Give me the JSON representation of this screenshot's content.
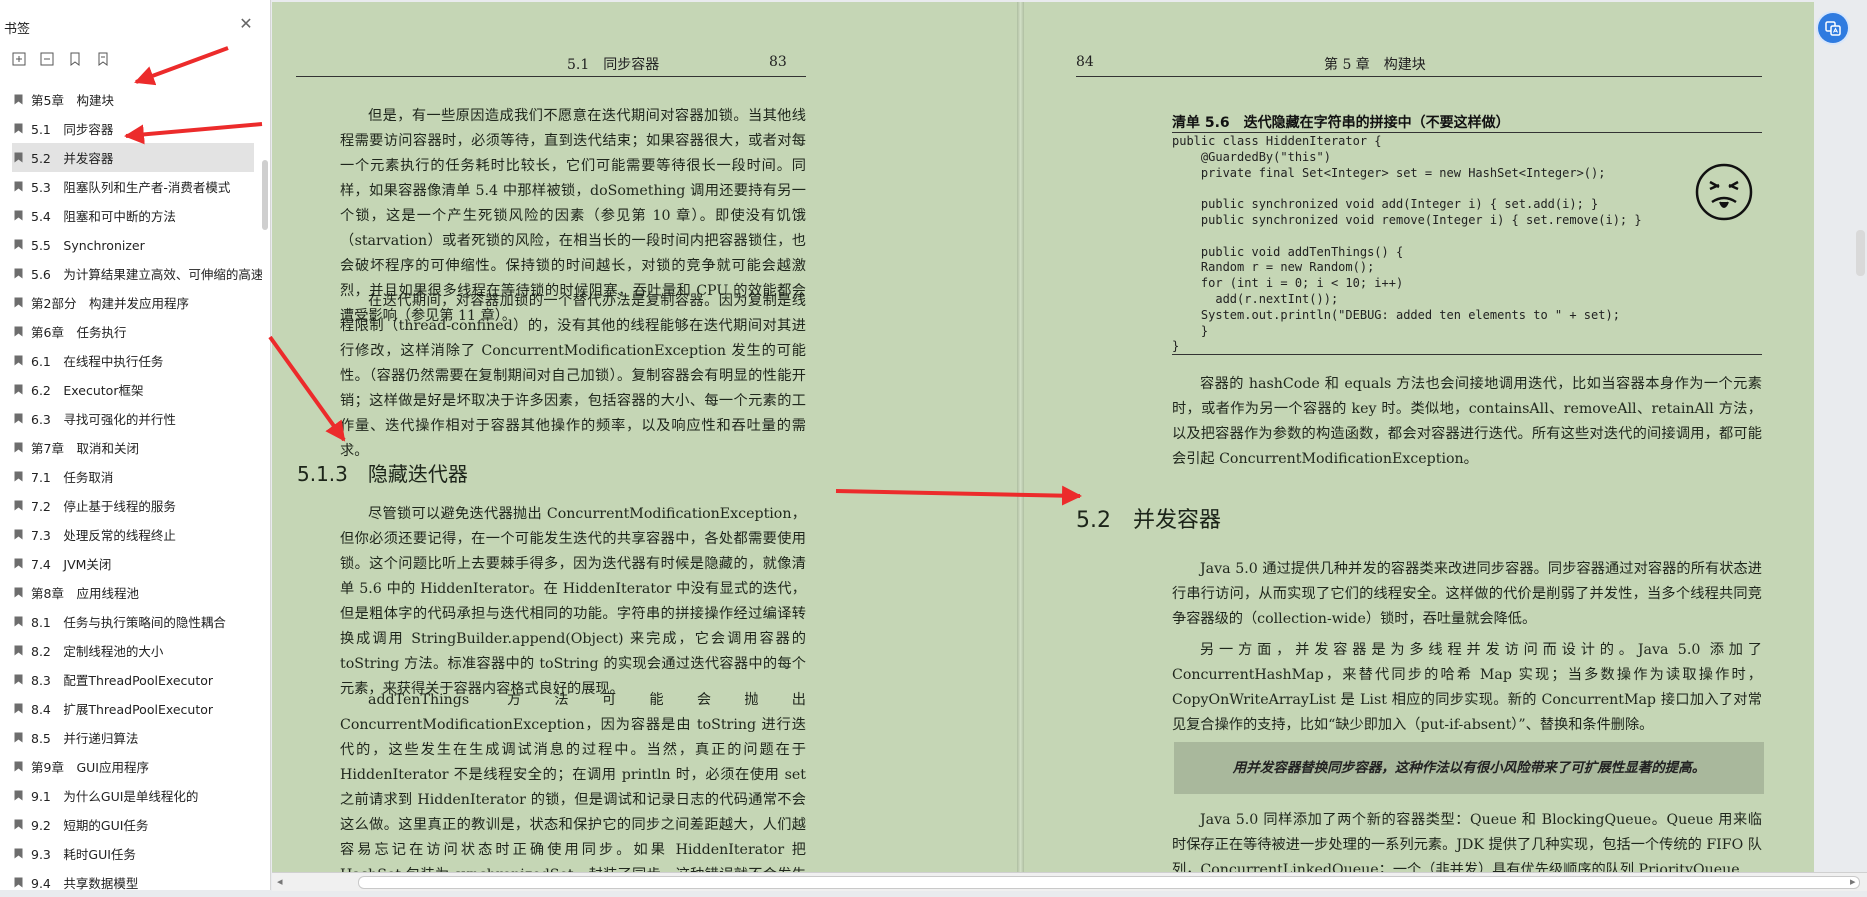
{
  "sidebar": {
    "title": "书签",
    "bookmarks": [
      {
        "label": "第5章　构建块"
      },
      {
        "label": "5.1　同步容器"
      },
      {
        "label": "5.2　并发容器"
      },
      {
        "label": "5.3　阻塞队列和生产者-消费者模式"
      },
      {
        "label": "5.4　阻塞和可中断的方法"
      },
      {
        "label": "5.5　Synchronizer"
      },
      {
        "label": "5.6　为计算结果建立高效、可伸缩的高速"
      },
      {
        "label": "第2部分　构建并发应用程序"
      },
      {
        "label": "第6章　任务执行"
      },
      {
        "label": "6.1　在线程中执行任务"
      },
      {
        "label": "6.2　Executor框架"
      },
      {
        "label": "6.3　寻找可强化的并行性"
      },
      {
        "label": "第7章　取消和关闭"
      },
      {
        "label": "7.1　任务取消"
      },
      {
        "label": "7.2　停止基于线程的服务"
      },
      {
        "label": "7.3　处理反常的线程终止"
      },
      {
        "label": "7.4　JVM关闭"
      },
      {
        "label": "第8章　应用线程池"
      },
      {
        "label": "8.1　任务与执行策略间的隐性耦合"
      },
      {
        "label": "8.2　定制线程池的大小"
      },
      {
        "label": "8.3　配置ThreadPoolExecutor"
      },
      {
        "label": "8.4　扩展ThreadPoolExecutor"
      },
      {
        "label": "8.5　并行递归算法"
      },
      {
        "label": "第9章　GUI应用程序"
      },
      {
        "label": "9.1　为什么GUI是单线程化的"
      },
      {
        "label": "9.2　短期的GUI任务"
      },
      {
        "label": "9.3　耗时GUI任务"
      },
      {
        "label": "9.4　共享数据模型"
      }
    ]
  },
  "left_page": {
    "running_head": "5.1　同步容器",
    "page_number": "83",
    "paragraphs": [
      "但是，有一些原因造成我们不愿意在迭代期间对容器加锁。当其他线程需要访问容器时，必须等待，直到迭代结束；如果容器很大，或者对每一个元素执行的任务耗时比较长，它们可能需要等待很长一段时间。同样，如果容器像清单 5.4 中那样被锁，doSomething 调用还要持有另一个锁，这是一个产生死锁风险的因素（参见第 10 章）。即使没有饥饿（starvation）或者死锁的风险，在相当长的一段时间内把容器锁住，也会破坏程序的可伸缩性。保持锁的时间越长，对锁的竞争就可能会越激烈，并且如果很多线程在等待锁的时候阻塞，吞吐量和 CPU 的效能都会遭受影响（参见第 11 章）。",
      "在迭代期间，对容器加锁的一个替代办法是复制容器。因为复制是线程限制（thread-confined）的，没有其他的线程能够在迭代期间对其进行修改，这样消除了 ConcurrentModificationException 发生的可能性。（容器仍然需要在复制期间对自己加锁）。复制容器会有明显的性能开销；这样做是好是坏取决于许多因素，包括容器的大小、每一个元素的工作量、迭代操作相对于容器其他操作的频率，以及响应性和吞吐量的需求。"
    ],
    "section_heading": "5.1.3　隐藏迭代器",
    "paragraphs2": [
      "尽管锁可以避免迭代器抛出 ConcurrentModificationException，但你必须还要记得，在一个可能发生迭代的共享容器中，各处都需要使用锁。这个问题比听上去要棘手得多，因为迭代器有时候是隐藏的，就像清单 5.6 中的 HiddenIterator。在 HiddenIterator 中没有显式的迭代，但是粗体字的代码承担与迭代相同的功能。字符串的拼接操作经过编译转换成调用 StringBuilder.append(Object) 来完成，它会调用容器的 toString 方法。标准容器中的 toString 的实现会通过迭代容器中的每个元素，来获得关于容器内容格式良好的展现。",
      "addTenThings 方法可能会抛出 ConcurrentModificationException，因为容器是由 toString 进行迭代的，这些发生在生成调试消息的过程中。当然，真正的问题在于 HiddenIterator 不是线程安全的；在调用 println 时，必须在使用 set 之前请求到 HiddenIterator 的锁，但是调试和记录日志的代码通常不会这么做。这里真正的教训是，状态和保护它的同步之间差距越大，人们越容易忘记在访问状态时正确使用同步。如果 HiddenIterator 把 HashSet 包装为 synchronizedSet，封装了同步，这种错误就不会发生了。"
    ]
  },
  "right_page": {
    "page_number": "84",
    "running_head": "第 5 章　构建块",
    "listing_title": "清单 5.6　迭代隐藏在字符串的拼接中（不要这样做）",
    "code": "public class HiddenIterator {\n    @GuardedBy(\"this\")\n    private final Set<Integer> set = new HashSet<Integer>();\n\n    public synchronized void add(Integer i) { set.add(i); }\n    public synchronized void remove(Integer i) { set.remove(i); }\n\n    public void addTenThings() {\n    Random r = new Random();\n    for (int i = 0; i < 10; i++)\n      add(r.nextInt());\n    System.out.println(\"DEBUG: added ten elements to \" + set);\n    }\n}",
    "para_after_code": "容器的 hashCode 和 equals 方法也会间接地调用迭代，比如当容器本身作为一个元素时，或者作为另一个容器的 key 时。类似地，containsAll、removeAll、retainAll 方法，以及把容器作为参数的构造函数，都会对容器进行迭代。所有这些对迭代的间接调用，都可能会引起 ConcurrentModificationException。",
    "section_heading": "5.2　并发容器",
    "paragraphs": [
      "Java 5.0 通过提供几种并发的容器类来改进同步容器。同步容器通过对容器的所有状态进行串行访问，从而实现了它们的线程安全。这样做的代价是削弱了并发性，当多个线程共同竞争容器级的（collection-wide）锁时，吞吐量就会降低。",
      "另一方面，并发容器是为多线程并发访问而设计的。Java 5.0 添加了 ConcurrentHashMap，来替代同步的哈希 Map 实现；当多数操作为读取操作时，CopyOnWriteArrayList 是 List 相应的同步实现。新的 ConcurrentMap 接口加入了对常见复合操作的支持，比如“缺少即加入（put-if-absent）”、替换和条件删除。"
    ],
    "callout": "用并发容器替换同步容器，这种作法以有很小风险带来了可扩展性显著的提高。",
    "paragraph_last": "Java 5.0 同样添加了两个新的容器类型：Queue 和 BlockingQueue。Queue 用来临时保存正在等待被进一步处理的一系列元素。JDK 提供了几种实现，包括一个传统的 FIFO 队列，ConcurrentLinkedQueue；一个（非并发）具有优先级顺序的队列 PriorityQueue"
  },
  "colors": {
    "page_bg": "#c5d6b5",
    "arrow": "#ec2b2b",
    "fab": "#2f7be0",
    "selected_bookmark": "#e3e3e3"
  },
  "icons": [
    "close-icon",
    "expand-all-icon",
    "collapse-all-icon",
    "add-bookmark-icon",
    "bookmark-outline-icon",
    "bookmark-icon",
    "translate-icon"
  ]
}
